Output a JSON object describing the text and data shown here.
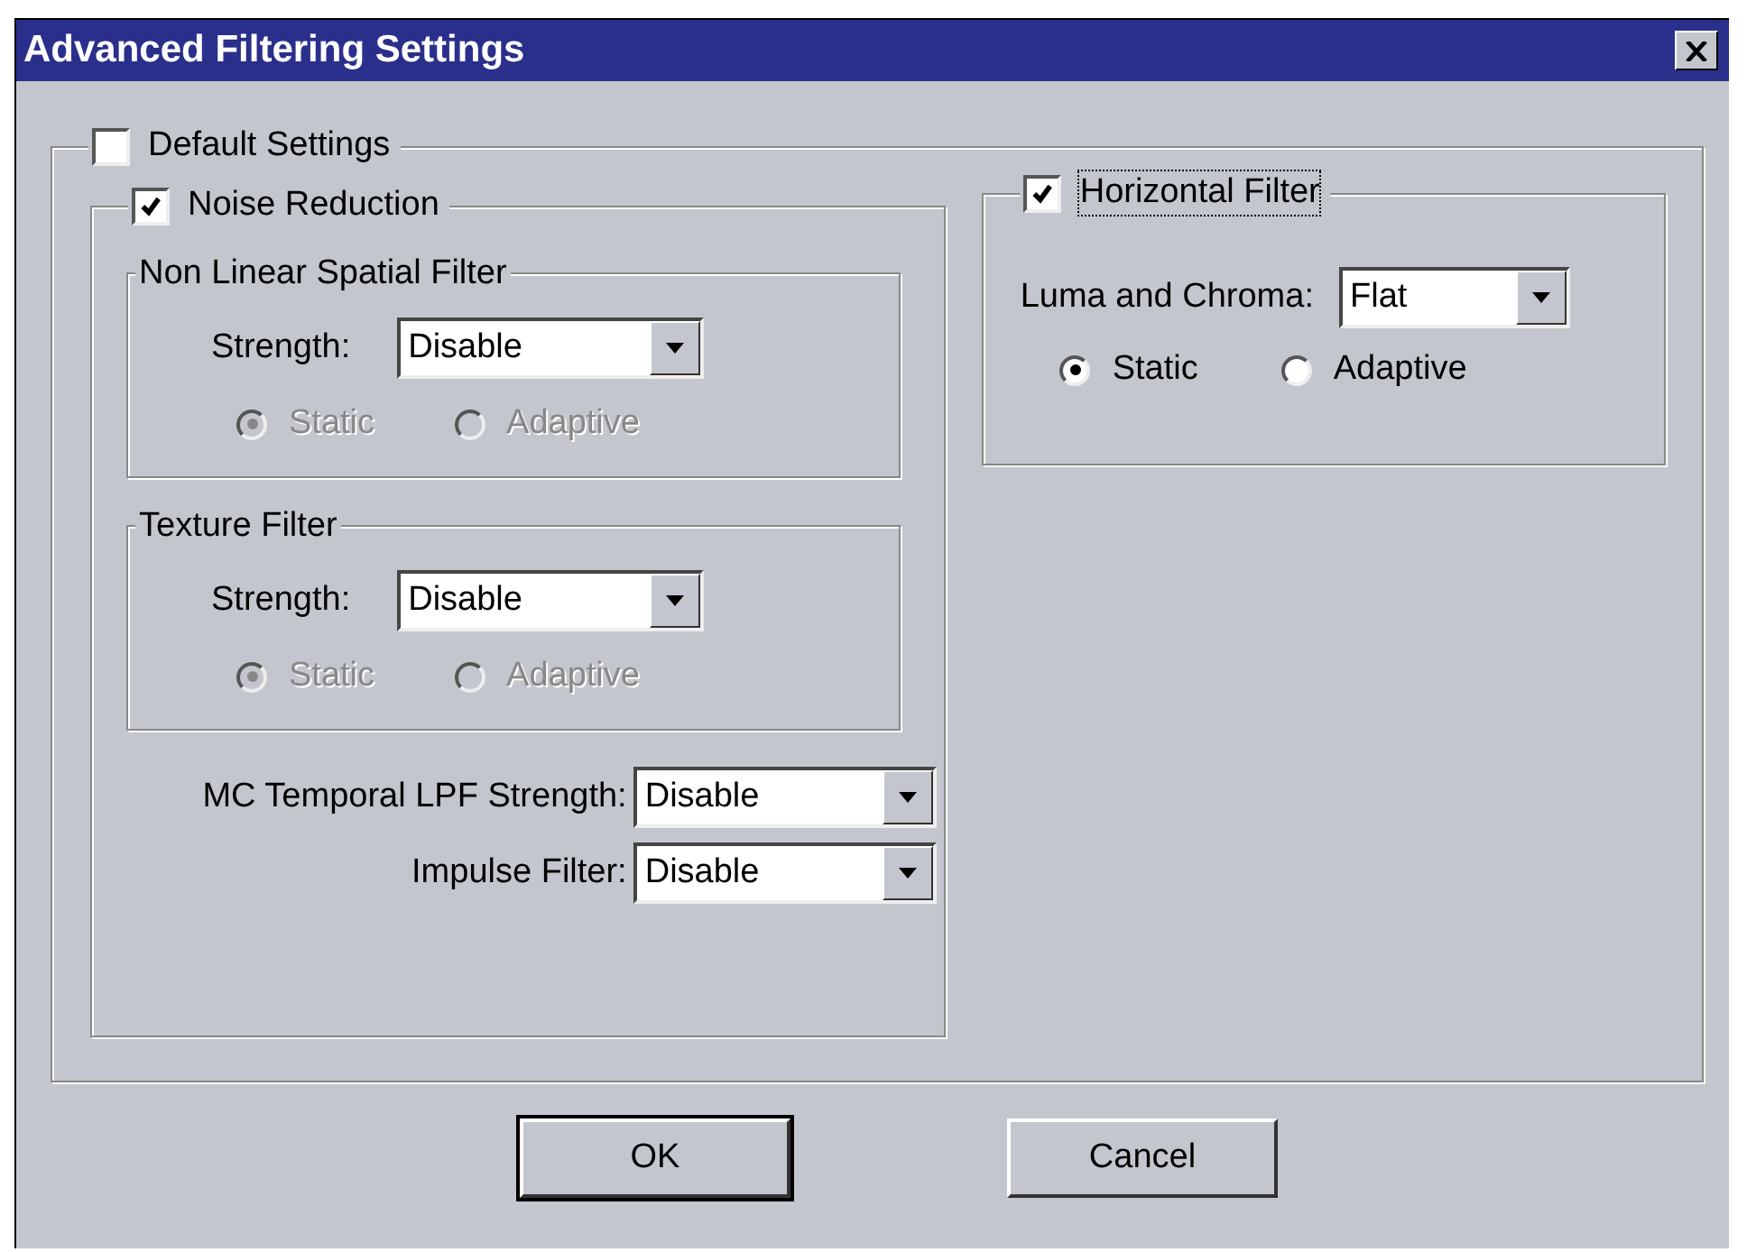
{
  "window": {
    "title": "Advanced Filtering Settings"
  },
  "default_settings": {
    "label": "Default Settings",
    "checked": false
  },
  "noise_reduction": {
    "label": "Noise Reduction",
    "checked": true,
    "groups": [
      {
        "title": "Non Linear Spatial Filter",
        "strength_label": "Strength:",
        "value": "Disable",
        "disabled": true,
        "radios": [
          {
            "label": "Static",
            "selected": true
          },
          {
            "label": "Adaptive",
            "selected": false
          }
        ]
      },
      {
        "title": "Texture Filter",
        "strength_label": "Strength:",
        "value": "Disable",
        "disabled": true,
        "radios": [
          {
            "label": "Static",
            "selected": true
          },
          {
            "label": "Adaptive",
            "selected": false
          }
        ]
      }
    ],
    "rows": [
      {
        "label": "MC Temporal LPF Strength:",
        "value": "Disable"
      },
      {
        "label": "Impulse Filter:",
        "value": "Disable"
      }
    ]
  },
  "horizontal_filter": {
    "label": "Horizontal Filter",
    "checked": true,
    "focused": true,
    "field_label": "Luma and Chroma:",
    "value": "Flat",
    "disabled": false,
    "radios": [
      {
        "label": "Static",
        "selected": true
      },
      {
        "label": "Adaptive",
        "selected": false
      }
    ]
  },
  "buttons": [
    {
      "label": "OK",
      "default": true
    },
    {
      "label": "Cancel",
      "default": false
    }
  ]
}
